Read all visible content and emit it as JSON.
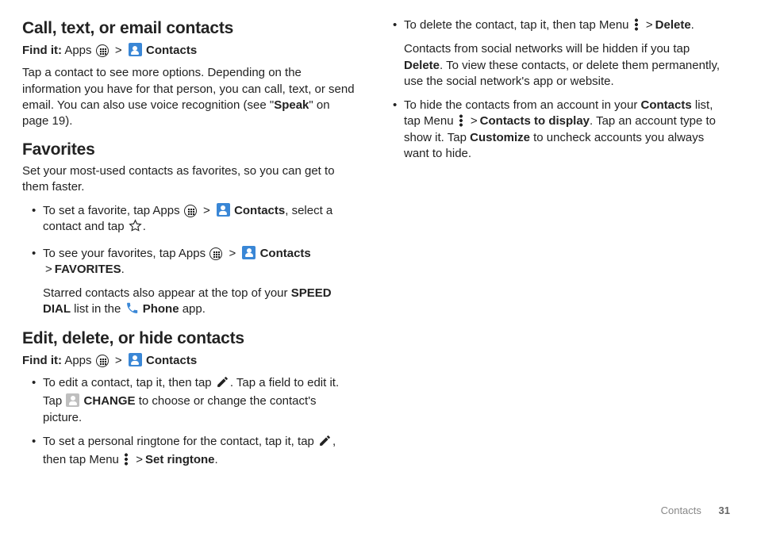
{
  "common": {
    "gt": ">",
    "find_it_prefix": "Find it:",
    "apps_label": "Apps",
    "contacts_label": "Contacts",
    "phone_label": "Phone"
  },
  "sec1": {
    "heading": "Call, text, or email contacts",
    "para_a": "Tap a contact to see more options. Depending on the information you have for that person, you can call, text, or send email. You can also use voice recognition (see \"",
    "speak": "Speak",
    "para_b": "\" on page 19)."
  },
  "sec2": {
    "heading": "Favorites",
    "intro": "Set your most-used contacts as favorites, so you can get to them faster.",
    "b1_a": "To set a favorite, tap Apps ",
    "b1_b": ", select a contact and tap ",
    "b1_c": ".",
    "b2_a": "To see your favorites, tap Apps ",
    "b2_favs": "FAVORITES",
    "b2_period": ".",
    "b2_sub_a": "Starred contacts also appear at the top of your ",
    "b2_speed": "SPEED DIAL",
    "b2_sub_b": " list in the ",
    "b2_sub_c": " app."
  },
  "sec3": {
    "heading": "Edit, delete, or hide contacts",
    "b1_a": "To edit a contact, tap it, then tap ",
    "b1_b": ". Tap a field to edit it. Tap ",
    "b1_change": "CHANGE",
    "b1_c": " to choose or change the contact's picture.",
    "b2_a": "To set a personal ringtone for the contact, tap it, tap ",
    "b2_b": ", then tap Menu ",
    "b2_set": "Set ringtone",
    "b2_c": "."
  },
  "sec3r": {
    "b3_a": "To delete the contact, tap it, then tap Menu ",
    "b3_del": "Delete",
    "b3_c": ".",
    "b3_sub_a": "Contacts from social networks will be hidden if you tap ",
    "b3_sub_del": "Delete",
    "b3_sub_b": ". To view these contacts, or delete them permanently, use the social network's app or website.",
    "b4_a": "To hide the contacts from an account in your ",
    "b4_contacts": "Contacts",
    "b4_b": " list, tap Menu ",
    "b4_ctd": "Contacts to display",
    "b4_c": ". Tap an account type to show it. Tap ",
    "b4_cust": "Customize",
    "b4_d": " to uncheck accounts you always want to hide."
  },
  "footer": {
    "section": "Contacts",
    "page": "31"
  }
}
